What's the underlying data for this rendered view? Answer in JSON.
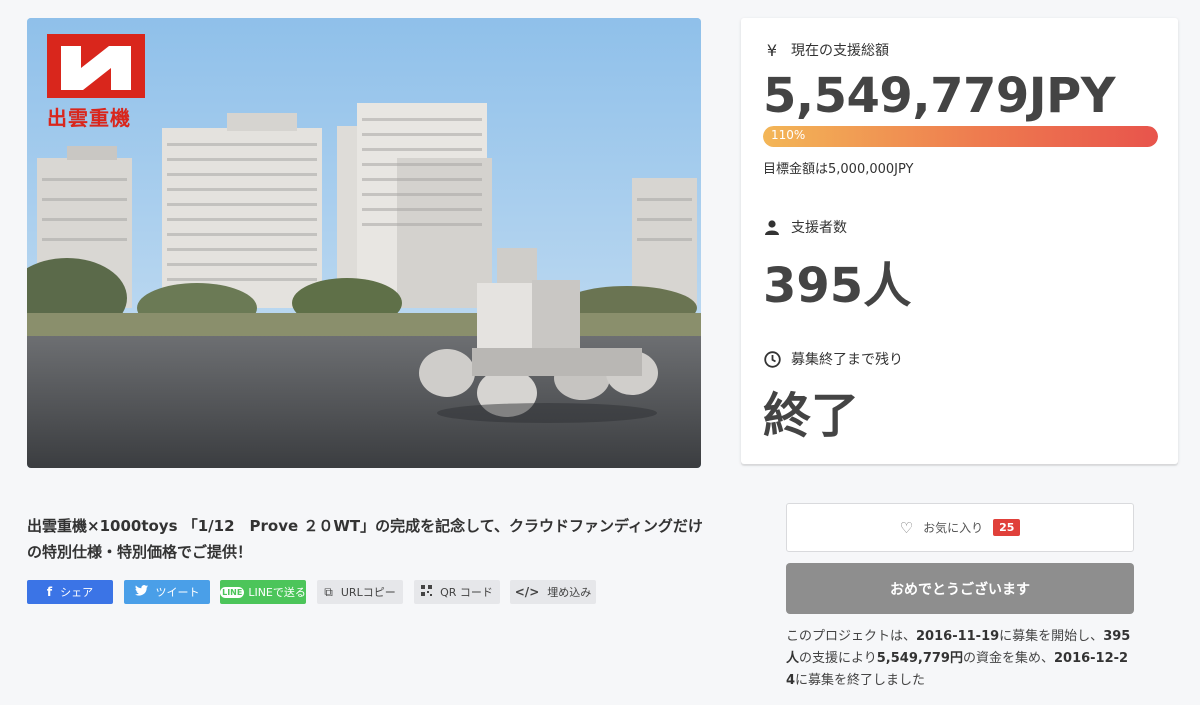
{
  "logo": {
    "text": "出雲重機"
  },
  "stats": {
    "amount_label": "現在の支援総額",
    "amount_value": "5,549,779JPY",
    "progress_label": "110%",
    "progress_fraction": 1.0,
    "goal_text": "目標金額は5,000,000JPY",
    "backers_label": "支援者数",
    "backers_value": "395人",
    "remaining_label": "募集終了まで残り",
    "remaining_value": "終了"
  },
  "project": {
    "description": "出雲重機×1000toys 「1/12　Prove ２０WT」の完成を記念して、クラウドファンディングだけの特別仕様・特別価格でご提供！"
  },
  "share": {
    "facebook": "シェア",
    "twitter": "ツイート",
    "line": "LINEで送る",
    "url": "URLコピー",
    "qr": "QR コード",
    "embed": "埋め込み"
  },
  "favorite": {
    "label": "お気に入り",
    "count": "25"
  },
  "status_button": "おめでとうございます",
  "summary": {
    "p1": "このプロジェクトは、",
    "start": "2016-11-19",
    "p2": "に募集を開始し、",
    "backers": "395人",
    "p3": "の支援により",
    "amount": "5,549,779円",
    "p4": "の資金を集め、",
    "end": "2016-12-24",
    "p5": "に募集を終了しました"
  },
  "colors": {
    "progress_start": "#f3b657",
    "progress_end": "#e8544c",
    "facebook": "#3b74e6",
    "twitter": "#4a9fe8",
    "line": "#4cc55a",
    "badge": "#e0403a",
    "logo": "#d9261c"
  },
  "icons": [
    "yen-icon",
    "user-icon",
    "clock-icon",
    "facebook-icon",
    "twitter-icon",
    "line-icon",
    "copy-icon",
    "qr-icon",
    "code-icon",
    "heart-icon"
  ]
}
